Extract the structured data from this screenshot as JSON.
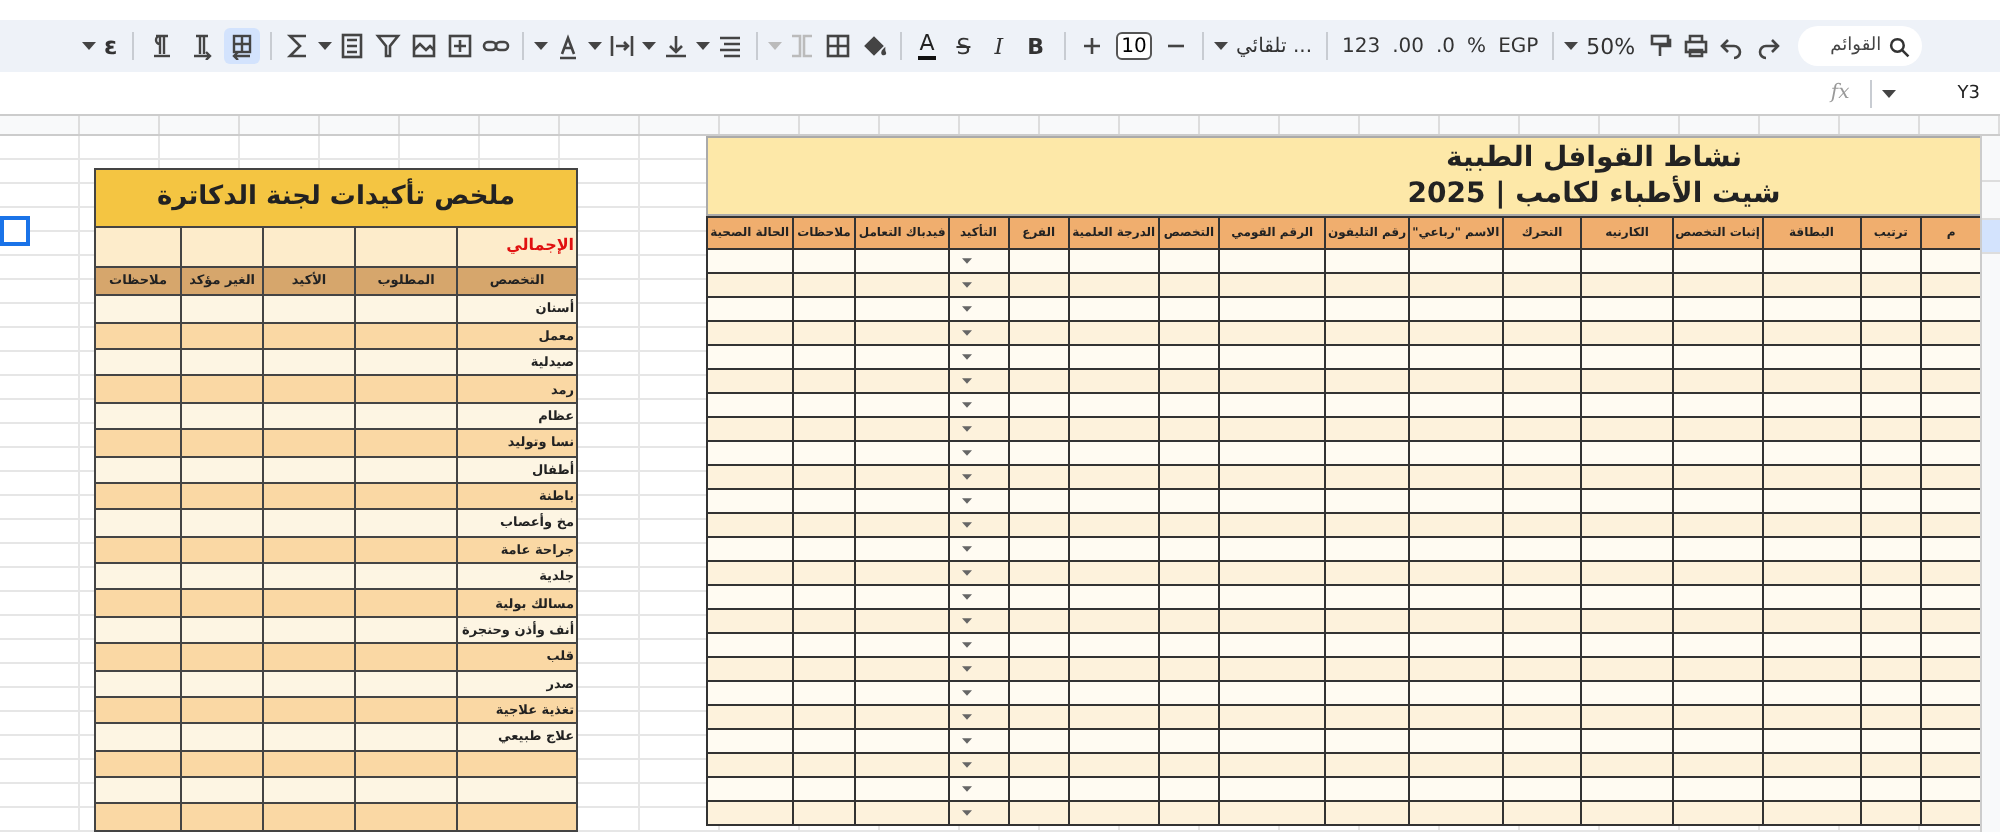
{
  "toolbar": {
    "search": {
      "placeholder": "القوائم"
    },
    "zoom": "50%",
    "currency": "EGP",
    "percent": "%",
    "decrease_decimal": ".0",
    "increase_decimal": ".00",
    "number_format": "123",
    "font": "تلقائي ...",
    "font_size": "10",
    "bold": "B",
    "italic": "I",
    "strikethrough": "S",
    "text_color": "A",
    "input_tools": "ε",
    "direction_buttons": [
      {
        "selected": false
      },
      {
        "selected": false
      },
      {
        "selected": true
      }
    ]
  },
  "formula_bar": {
    "name_box": "Y3",
    "fx": "fx"
  },
  "row_headers": [
    {
      "selected": false
    },
    {
      "selected": false
    },
    {
      "selected": true
    }
  ],
  "summary_table": {
    "title": "ملخص تأكيدات لجنة الدكاترة",
    "total_label": "الإجمالي",
    "columns": [
      "التخصص",
      "المطلوب",
      "الأكيد",
      "الغير مؤكد",
      "ملاحظات"
    ],
    "rows": [
      "أسنان",
      "معمل",
      "صيدلية",
      "رمد",
      "عظام",
      "نسا وتوليد",
      "أطفال",
      "باطنة",
      "مخ وأعصاب",
      "جراحة عامة",
      "جلدية",
      "مسالك بولية",
      "أنف وأذن وحنجرة",
      "قلب",
      "صدر",
      "تغذية علاجية",
      "علاج طبيعي",
      "",
      "",
      ""
    ]
  },
  "doctors_sheet": {
    "title": "نشاط القوافل الطبية",
    "subtitle": "شيت الأطباء لكامب | 2025",
    "columns": [
      {
        "label": "م",
        "kind": "text"
      },
      {
        "label": "ترتيب",
        "kind": "text"
      },
      {
        "label": "البطاقة",
        "kind": "text"
      },
      {
        "label": "إثبات التخصص",
        "kind": "text"
      },
      {
        "label": "الكارنيه",
        "kind": "text"
      },
      {
        "label": "التحرك",
        "kind": "text"
      },
      {
        "label": "الاسم \"رباعي\"",
        "kind": "text"
      },
      {
        "label": "رقم التليفون",
        "kind": "text"
      },
      {
        "label": "الرقم القومي",
        "kind": "text"
      },
      {
        "label": "التخصص",
        "kind": "text"
      },
      {
        "label": "الدرجة العلمية",
        "kind": "text"
      },
      {
        "label": "الفرع",
        "kind": "text"
      },
      {
        "label": "التأكيد",
        "kind": "dropdown"
      },
      {
        "label": "فيدباك التعامل",
        "kind": "text"
      },
      {
        "label": "ملاحظات",
        "kind": "text"
      },
      {
        "label": "الحالة الصحية",
        "kind": "text"
      }
    ]
  }
}
